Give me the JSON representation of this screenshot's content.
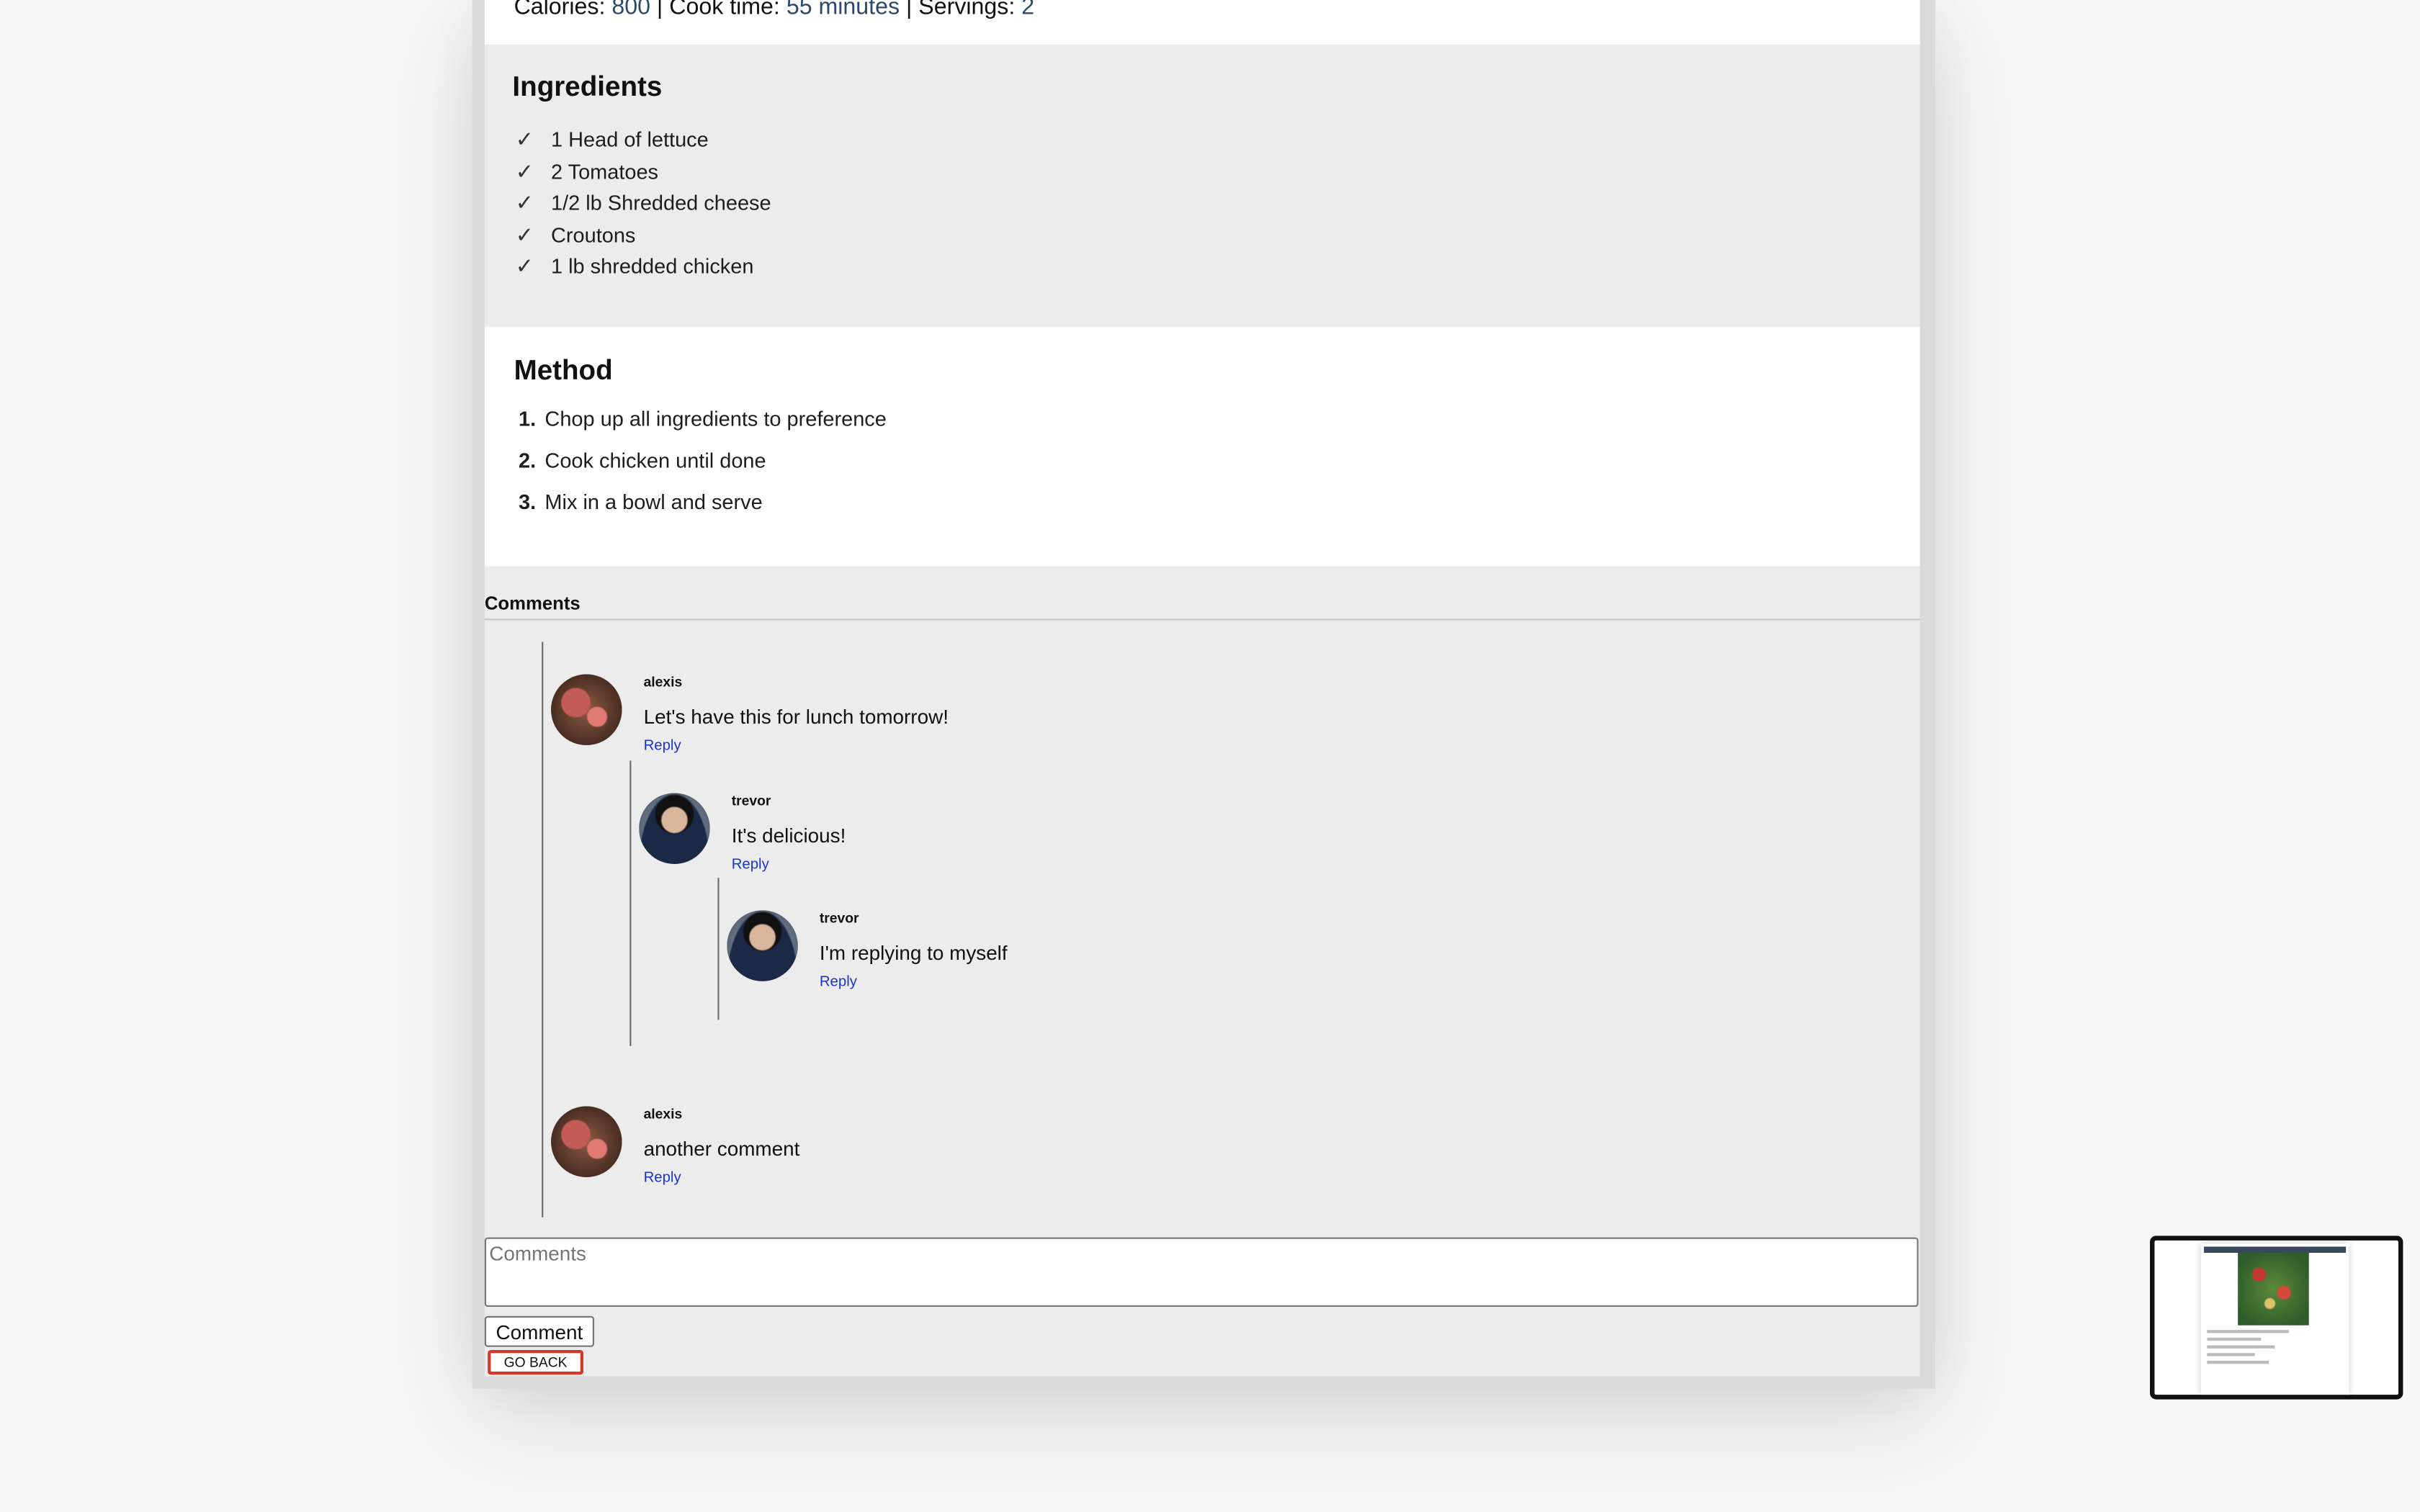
{
  "meta": {
    "calories_label": "Calories:",
    "calories_value": "800",
    "sep1": "|",
    "cook_time_label": "Cook time:",
    "cook_time_value": "55 minutes",
    "sep2": "|",
    "servings_label": "Servings:",
    "servings_value": "2"
  },
  "ingredients": {
    "title": "Ingredients",
    "check_glyph": "✓",
    "items": [
      "1 Head of lettuce",
      "2 Tomatoes",
      "1/2 lb Shredded cheese",
      "Croutons",
      "1 lb shredded chicken"
    ]
  },
  "method": {
    "title": "Method",
    "steps": [
      {
        "num": "1.",
        "text": "Chop up all ingredients to preference"
      },
      {
        "num": "2.",
        "text": "Cook chicken until done"
      },
      {
        "num": "3.",
        "text": "Mix in a bowl and serve"
      }
    ]
  },
  "comments": {
    "title": "Comments",
    "reply_label": "Reply",
    "items": [
      {
        "user": "alexis",
        "text": "Let's have this for lunch tomorrow!"
      },
      {
        "user": "trevor",
        "text": "It's delicious!"
      },
      {
        "user": "trevor",
        "text": "I'm replying to myself"
      },
      {
        "user": "alexis",
        "text": "another comment"
      }
    ],
    "input_placeholder": "Comments",
    "submit_label": "Comment",
    "back_label": "GO BACK"
  },
  "colors": {
    "link": "#1a35cc",
    "meta_value": "#2b4a6b",
    "go_back_border": "#d6372b",
    "section_bg": "#ececec"
  }
}
